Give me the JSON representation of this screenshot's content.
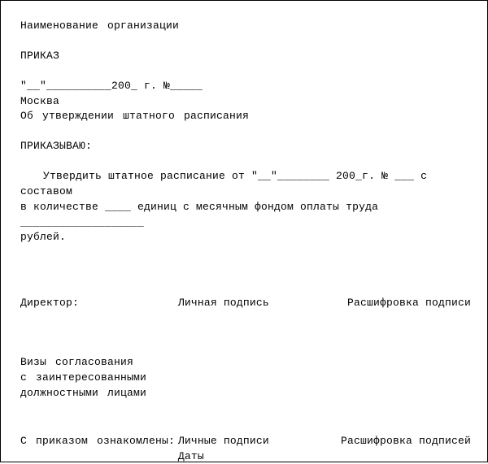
{
  "header": {
    "org_name": "Наименование организации",
    "order": "ПРИКАЗ",
    "date_line": "\"__\"__________200_ г. №_____",
    "city": "Москва",
    "subject": "Об утверждении штатного расписания"
  },
  "body": {
    "command": "ПРИКАЗЫВАЮ:",
    "text_line1": "Утвердить штатное расписание от \"__\"________ 200_г. № ___ с составом",
    "text_line2": "в количестве ____ единиц с месячным фондом оплаты труда ___________________",
    "text_line3": "рублей."
  },
  "signatures": {
    "director": "Директор:",
    "personal_sign": "Личная подпись",
    "decipher_sign": "Расшифровка подписи",
    "visas_line1": "Визы согласования",
    "visas_line2": "с заинтересованными",
    "visas_line3": "должностными лицами",
    "ack": "С приказом ознакомлены:",
    "personal_signs": "Личные подписи",
    "decipher_signs": "Расшифровка подписей",
    "dates": "Даты"
  }
}
